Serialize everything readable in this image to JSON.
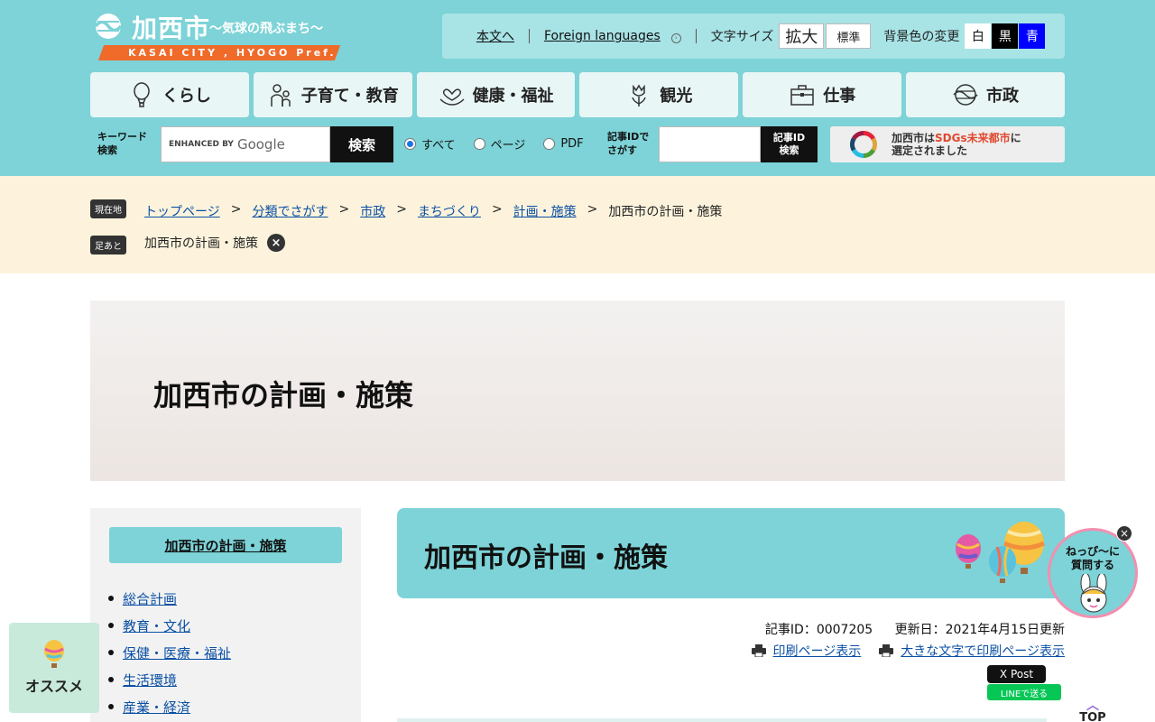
{
  "logo": {
    "name": "加西市",
    "tagline": "〜気球の飛ぶまち〜",
    "subtitle": "KASAI CITY , HYOGO Pref."
  },
  "util": {
    "skip": "本文へ",
    "foreign": "Foreign languages",
    "font_size_label": "文字サイズ",
    "font_large": "拡大",
    "font_standard": "標準",
    "bg_label": "背景色の変更",
    "bg_white": "白",
    "bg_black": "黒",
    "bg_blue": "青"
  },
  "nav": [
    {
      "label": "くらし",
      "icon": "balloon-icon"
    },
    {
      "label": "子育て・教育",
      "icon": "family-icon"
    },
    {
      "label": "健康・福祉",
      "icon": "hands-heart-icon"
    },
    {
      "label": "観光",
      "icon": "tulip-icon"
    },
    {
      "label": "仕事",
      "icon": "briefcase-icon"
    },
    {
      "label": "市政",
      "icon": "city-emblem-icon"
    }
  ],
  "search": {
    "keyword_label_1": "キーワード",
    "keyword_label_2": "検索",
    "enhanced": "ENHANCED BY",
    "google": "Google",
    "button": "検索",
    "radio_all": "すべて",
    "radio_page": "ページ",
    "radio_pdf": "PDF",
    "id_label_1": "記事IDで",
    "id_label_2": "さがす",
    "id_button_1": "記事ID",
    "id_button_2": "検索"
  },
  "sdgs": {
    "line1_a": "加西市は",
    "line1_b": "SDGs未来都市",
    "line1_c": "に",
    "line2": "選定されました"
  },
  "breadcrumb": {
    "badge_current": "現在地",
    "badge_history": "足あと",
    "items": [
      "トップページ",
      "分類でさがす",
      "市政",
      "まちづくり",
      "計画・施策"
    ],
    "current": "加西市の計画・施策",
    "sep": ">",
    "history_item": "加西市の計画・施策"
  },
  "hero": {
    "title": "加西市の計画・施策"
  },
  "sidebar": {
    "heading": "加西市の計画・施策",
    "items": [
      "総合計画",
      "教育・文化",
      "保健・医療・福祉",
      "生活環境",
      "産業・経済"
    ]
  },
  "main": {
    "title": "加西市の計画・施策",
    "article_id": "記事ID：0007205",
    "updated": "更新日：2021年4月15日更新",
    "print": "印刷ページ表示",
    "print_large": "大きな文字で印刷ページ表示",
    "x_post": "X Post",
    "line": "LINEで送る"
  },
  "floating": {
    "osusume": "オススメ",
    "chat_1": "ねっぴ〜に",
    "chat_2": "質問する",
    "top": "TOP"
  },
  "colors": {
    "header": "#7dd3d7",
    "accent": "#f06a2a",
    "link": "#0b50a4",
    "crumb_bg": "#fdf3dc"
  }
}
